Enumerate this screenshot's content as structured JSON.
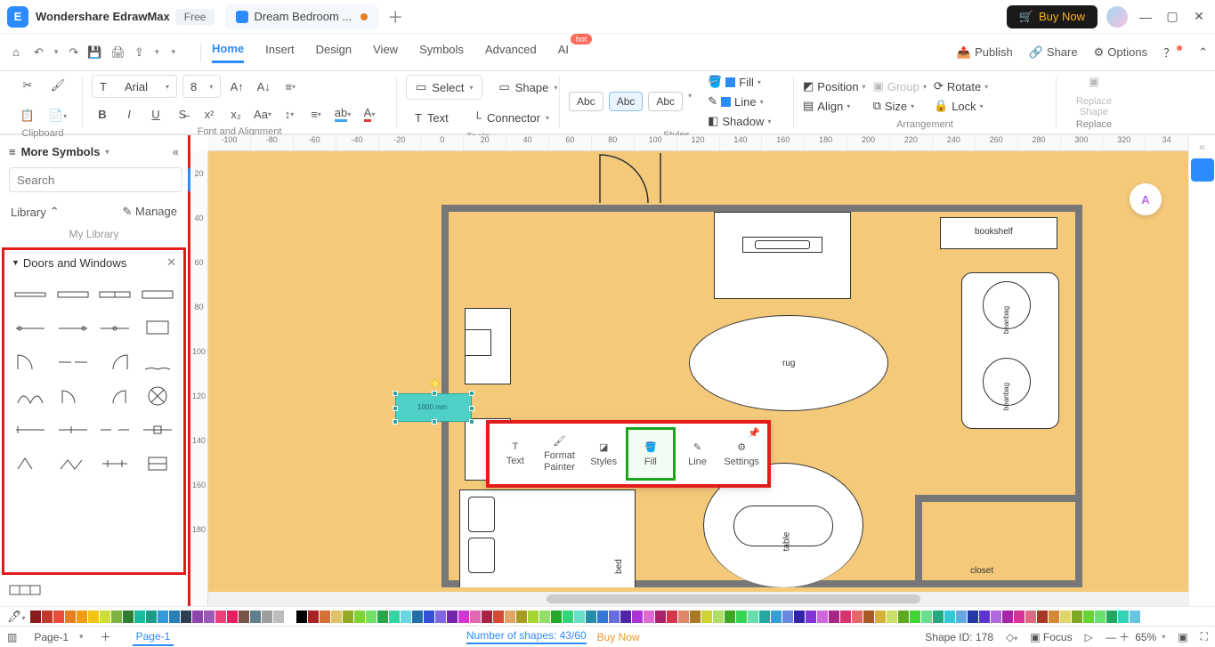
{
  "app": {
    "name": "Wondershare EdrawMax",
    "badge": "Free"
  },
  "tab": {
    "title": "Dream Bedroom ..."
  },
  "titlebar": {
    "buy_now": "Buy Now"
  },
  "menubar": {
    "items": [
      "Home",
      "Insert",
      "Design",
      "View",
      "Symbols",
      "Advanced",
      "AI"
    ],
    "active": "Home",
    "right": {
      "publish": "Publish",
      "share": "Share",
      "options": "Options"
    }
  },
  "ribbon": {
    "clipboard_label": "Clipboard",
    "font_label": "Font and Alignment",
    "font_family": "Arial",
    "font_size": "8",
    "tools_label": "Tools",
    "select": "Select",
    "shape": "Shape",
    "text": "Text",
    "connector": "Connector",
    "style_chips": [
      "Abc",
      "Abc",
      "Abc"
    ],
    "styles_label": "Styles",
    "fill": "Fill",
    "line": "Line",
    "shadow": "Shadow",
    "arrangement_label": "Arrangement",
    "position": "Position",
    "group": "Group",
    "rotate": "Rotate",
    "align": "Align",
    "size": "Size",
    "lock": "Lock",
    "replace_label": "Replace",
    "replace_shape": "Replace\nShape"
  },
  "sidebar": {
    "header": "More Symbols",
    "search_placeholder": "Search",
    "search_btn": "Search",
    "library": "Library",
    "manage": "Manage",
    "mylib": "My Library",
    "category": "Doors and Windows"
  },
  "mini_toolbar": {
    "items": [
      "Text",
      "Format Painter",
      "Styles",
      "Fill",
      "Line",
      "Settings"
    ],
    "highlighted": "Fill"
  },
  "canvas_labels": {
    "bookshelf": "bookshelf",
    "rug": "rug",
    "beanbag": "beanbag",
    "table": "table",
    "bed": "bed",
    "closet": "closet"
  },
  "ruler_h": [
    "-100",
    "-80",
    "-60",
    "-40",
    "-20",
    "0",
    "20",
    "40",
    "60",
    "80",
    "100",
    "120",
    "140",
    "160",
    "180",
    "200",
    "220",
    "240",
    "260",
    "280",
    "300",
    "320",
    "34"
  ],
  "ruler_v": [
    "20",
    "40",
    "60",
    "80",
    "100",
    "120",
    "140",
    "160",
    "180"
  ],
  "colorbar_note": "",
  "statusbar": {
    "page_label": "Page-1",
    "page_tab": "Page-1",
    "num_shapes": "Number of shapes: 43/60",
    "buy_now": "Buy Now",
    "shape_id": "Shape ID: 178",
    "focus": "Focus",
    "zoom": "65%"
  }
}
